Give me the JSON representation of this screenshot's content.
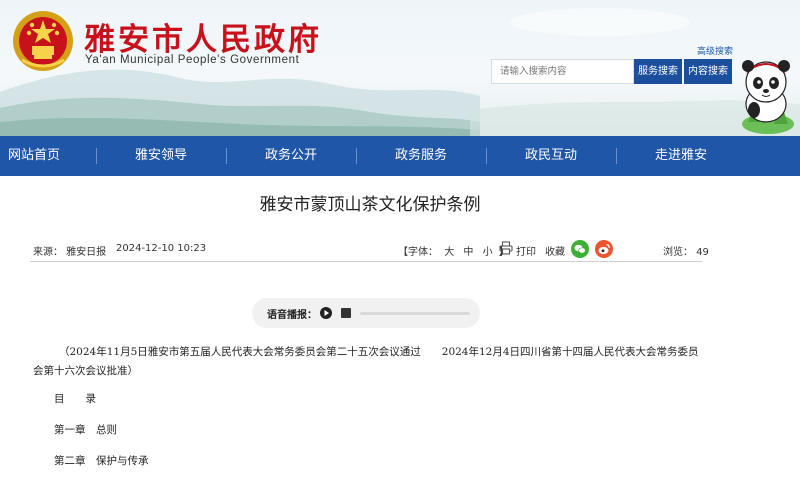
{
  "header": {
    "title": "雅安市人民政府",
    "subtitle": "Ya'an Municipal People's Government",
    "advanced_search": "高级搜索",
    "search_placeholder": "请输入搜索内容",
    "service_search": "服务搜索",
    "content_search": "内容搜索"
  },
  "nav": {
    "items": [
      "网站首页",
      "雅安领导",
      "政务公开",
      "政务服务",
      "政民互动",
      "走进雅安"
    ]
  },
  "article": {
    "title": "雅安市蒙顶山茶文化保护条例",
    "source": "来源： 雅安日报",
    "time": "2024-12-10 10:23",
    "font_label": "【字体：",
    "font_large": "大",
    "font_medium": "中",
    "font_small": "小",
    "font_close": "】",
    "print": "打印",
    "favorite": "收藏",
    "views": "浏览： 49",
    "audio_label": "语音播报：",
    "audio_progress": 0,
    "intro": "（2024年11月5日雅安市第五届人民代表大会常务委员会第二十五次会议通过　　2024年12月4日四川省第十四届人民代表大会常务委员会第十六次会议批准）",
    "toc": "目　　录",
    "chapter1": "第一章　总则",
    "chapter2": "第二章　保护与传承"
  },
  "colors": {
    "nav_bg": "#1f56a8",
    "title_red": "#c8121b",
    "search_btn": "#1b4f9e",
    "wechat": "#3cb034",
    "weibo": "#e8552f"
  },
  "icons": {
    "emblem": "national-emblem-icon",
    "print": "printer-icon",
    "wechat": "wechat-icon",
    "weibo": "weibo-icon",
    "play": "play-icon",
    "stop": "stop-icon",
    "mascot": "panda-mascot"
  }
}
